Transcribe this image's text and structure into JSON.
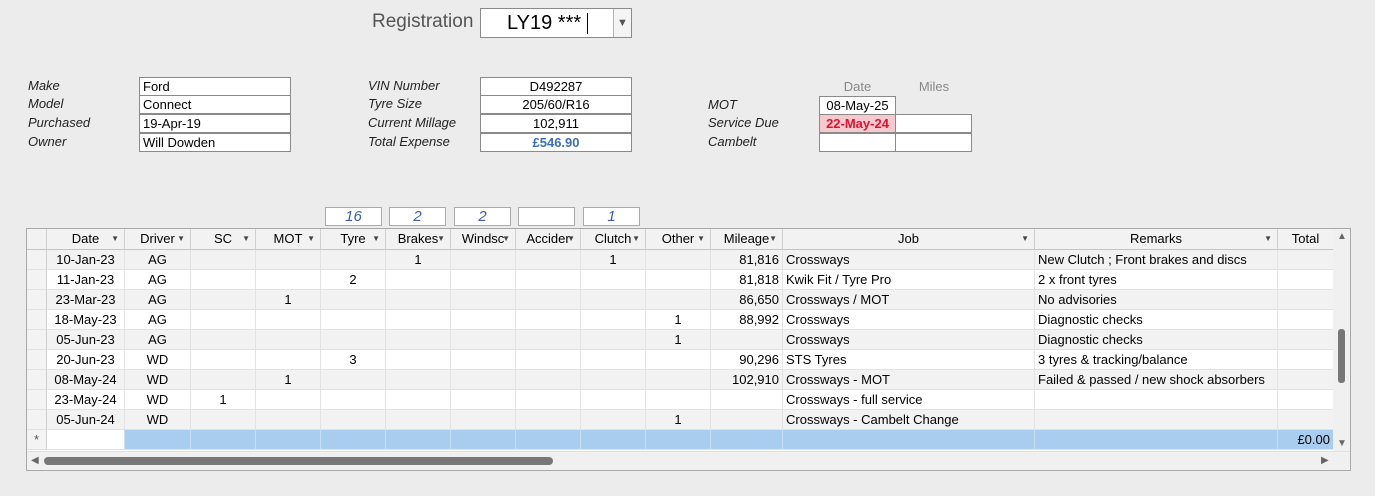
{
  "registration": {
    "label": "Registration",
    "value": "LY19 ***"
  },
  "vehicle": {
    "make_label": "Make",
    "make": "Ford",
    "model_label": "Model",
    "model": "Connect",
    "purchased_label": "Purchased",
    "purchased": "19-Apr-19",
    "owner_label": "Owner",
    "owner": "Will Dowden"
  },
  "details": {
    "vin_label": "VIN Number",
    "vin": "D492287",
    "tyre_label": "Tyre Size",
    "tyre": "205/60/R16",
    "mileage_label": "Current Millage",
    "mileage": "102,911",
    "expense_label": "Total Expense",
    "expense": "£546.90",
    "expense_color": "#3b6fb6"
  },
  "due": {
    "date_header": "Date",
    "miles_header": "Miles",
    "mot_label": "MOT",
    "mot_date": "08-May-25",
    "mot_miles": "",
    "service_label": "Service Due",
    "service_date": "22-May-24",
    "service_miles": "",
    "service_highlight": "#f6c9cf",
    "service_text_color": "#e0122b",
    "cambelt_label": "Cambelt",
    "cambelt_date": "",
    "cambelt_miles": ""
  },
  "totals": {
    "tyre": "16",
    "brakes": "2",
    "windscreen": "2",
    "accident": "",
    "clutch": "1"
  },
  "grid": {
    "columns": [
      "Date",
      "Driver",
      "SC",
      "MOT",
      "Tyre",
      "Brakes",
      "Windsc",
      "Accider",
      "Clutch",
      "Other",
      "Mileage",
      "Job",
      "Remarks",
      "Total"
    ],
    "rows": [
      [
        "10-Jan-23",
        "AG",
        "",
        "",
        "",
        "1",
        "",
        "",
        "1",
        "",
        "81,816",
        "Crossways",
        "New Clutch ; Front brakes and discs",
        ""
      ],
      [
        "11-Jan-23",
        "AG",
        "",
        "",
        "2",
        "",
        "",
        "",
        "",
        "",
        "81,818",
        "Kwik Fit / Tyre Pro",
        "2 x front tyres",
        ""
      ],
      [
        "23-Mar-23",
        "AG",
        "",
        "1",
        "",
        "",
        "",
        "",
        "",
        "",
        "86,650",
        "Crossways / MOT",
        "No advisories",
        ""
      ],
      [
        "18-May-23",
        "AG",
        "",
        "",
        "",
        "",
        "",
        "",
        "",
        "1",
        "88,992",
        "Crossways",
        "Diagnostic checks",
        ""
      ],
      [
        "05-Jun-23",
        "AG",
        "",
        "",
        "",
        "",
        "",
        "",
        "",
        "1",
        "",
        "Crossways",
        "Diagnostic checks",
        ""
      ],
      [
        "20-Jun-23",
        "WD",
        "",
        "",
        "3",
        "",
        "",
        "",
        "",
        "",
        "90,296",
        "STS Tyres",
        "3 tyres & tracking/balance",
        ""
      ],
      [
        "08-May-24",
        "WD",
        "",
        "1",
        "",
        "",
        "",
        "",
        "",
        "",
        "102,910",
        "Crossways - MOT",
        "Failed & passed / new shock absorbers",
        ""
      ],
      [
        "23-May-24",
        "WD",
        "1",
        "",
        "",
        "",
        "",
        "",
        "",
        "",
        "",
        "Crossways - full service",
        "",
        ""
      ],
      [
        "05-Jun-24",
        "WD",
        "",
        "",
        "",
        "",
        "",
        "",
        "",
        "1",
        "",
        "Crossways - Cambelt Change",
        "",
        ""
      ]
    ],
    "new_row_marker": "*",
    "new_row_total": "£0.00",
    "new_row_color": "#a9cdee"
  }
}
